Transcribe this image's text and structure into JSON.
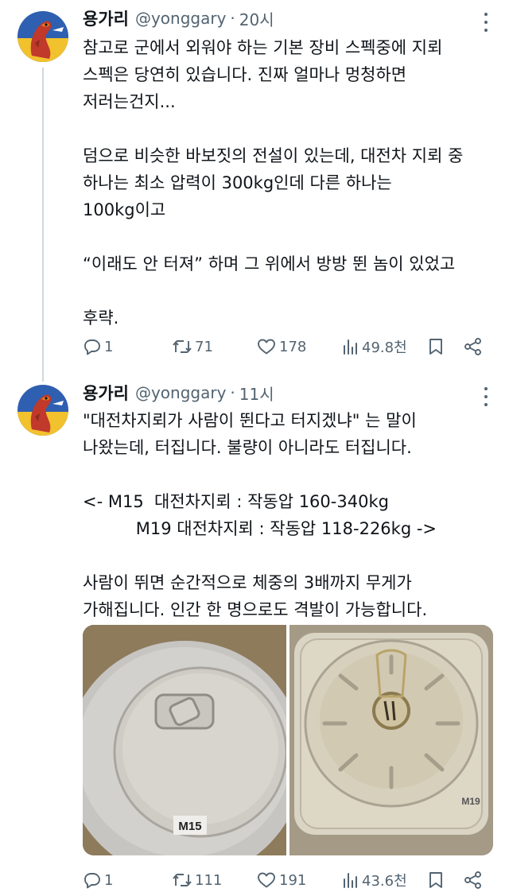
{
  "tweets": [
    {
      "name": "용가리",
      "handle": "@yonggary",
      "separator": "·",
      "time": "20시",
      "text": "참고로 군에서 외워야 하는 기본 장비 스펙중에 지뢰\n스펙은 당연히 있습니다. 진짜 얼마나 멍청하면\n저러는건지...\n\n덤으로 비슷한 바보짓의 전설이 있는데, 대전차 지뢰 중\n하나는 최소 압력이 300kg인데 다른 하나는\n100kg이고\n\n“이래도 안 터져” 하며 그 위에서 방방 뛴 놈이 있었고\n\n후략.",
      "replies": "1",
      "retweets": "71",
      "likes": "178",
      "views": "49.8천"
    },
    {
      "name": "용가리",
      "handle": "@yonggary",
      "separator": "·",
      "time": "11시",
      "text": "\"대전차지뢰가 사람이 뛴다고 터지겠냐\" 는 말이\n나왔는데, 터집니다. 불량이 아니라도 터집니다.\n\n<- M15  대전차지뢰 : 작동압 160-340kg\n          M19 대전차지뢰 : 작동압 118-226kg ->\n\n사람이 뛰면 순간적으로 체중의 3배까지 무게가\n가해집니다. 인간 한 명으로도 격발이 가능합니다.",
      "replies": "1",
      "retweets": "111",
      "likes": "191",
      "views": "43.6천",
      "images": [
        {
          "label": "M15",
          "icon": "m15-antitank-mine-photo"
        },
        {
          "label": "M19",
          "icon": "m19-antitank-mine-photo"
        }
      ]
    }
  ],
  "icons": {
    "reply": "reply-icon",
    "retweet": "retweet-icon",
    "like": "like-icon",
    "views": "views-icon",
    "bookmark": "bookmark-icon",
    "share": "share-icon",
    "more": "more-icon"
  },
  "colors": {
    "text": "#0f1419",
    "secondary": "#536471",
    "thread_line": "#cfd9de"
  }
}
